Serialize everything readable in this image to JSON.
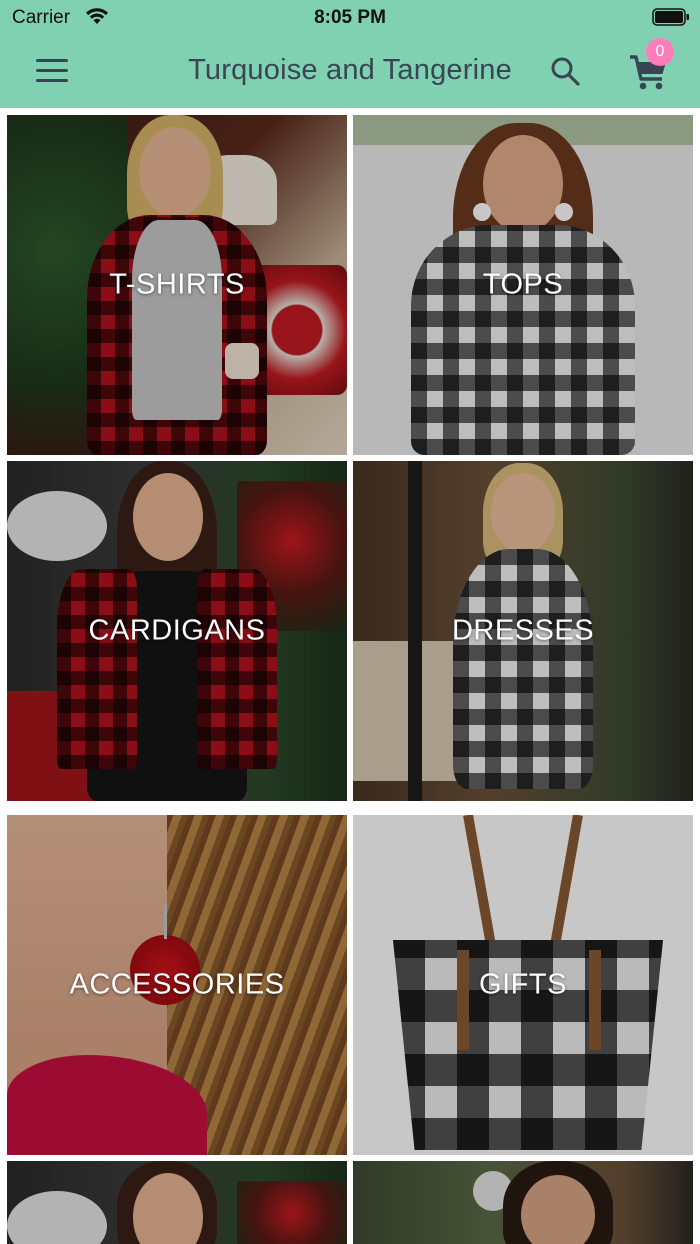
{
  "status_bar": {
    "carrier": "Carrier",
    "time": "8:05 PM"
  },
  "header": {
    "title": "Turquoise and Tangerine",
    "cart_count": "0",
    "bg_color": "#7fd1b2",
    "text_color": "#3a4553",
    "badge_color": "#ff7eb9",
    "icons": [
      "menu-icon",
      "search-icon",
      "cart-icon"
    ]
  },
  "categories": [
    {
      "label": "T-SHIRTS"
    },
    {
      "label": "TOPS"
    },
    {
      "label": "CARDIGANS"
    },
    {
      "label": "DRESSES"
    },
    {
      "label": "ACCESSORIES"
    },
    {
      "label": "GIFTS"
    },
    {
      "label": ""
    },
    {
      "label": ""
    }
  ]
}
